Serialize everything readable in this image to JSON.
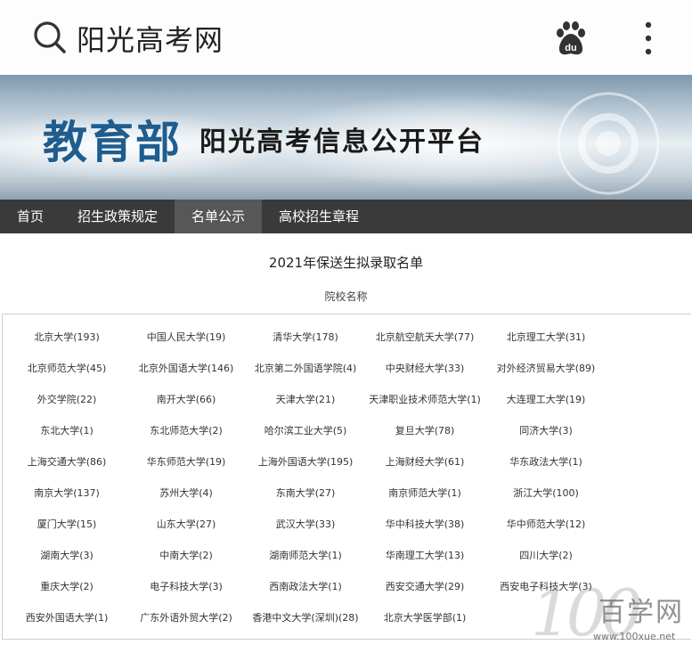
{
  "appbar": {
    "title": "阳光高考网",
    "icons": [
      "search-icon",
      "baidu-paw-icon",
      "more-vertical-icon"
    ]
  },
  "banner": {
    "ministry": "教育部",
    "platform": "阳光高考信息公开平台"
  },
  "nav": {
    "items": [
      {
        "label": "首页"
      },
      {
        "label": "招生政策规定"
      },
      {
        "label": "名单公示",
        "active": true
      },
      {
        "label": "高校招生章程"
      }
    ]
  },
  "page": {
    "heading": "2021年保送生拟录取名单",
    "column_heading": "院校名称"
  },
  "schools": [
    [
      "北京大学(193)",
      "中国人民大学(19)",
      "清华大学(178)",
      "北京航空航天大学(77)",
      "北京理工大学(31)"
    ],
    [
      "北京师范大学(45)",
      "北京外国语大学(146)",
      "北京第二外国语学院(4)",
      "中央财经大学(33)",
      "对外经济贸易大学(89)"
    ],
    [
      "外交学院(22)",
      "南开大学(66)",
      "天津大学(21)",
      "天津职业技术师范大学(1)",
      "大连理工大学(19)"
    ],
    [
      "东北大学(1)",
      "东北师范大学(2)",
      "哈尔滨工业大学(5)",
      "复旦大学(78)",
      "同济大学(3)"
    ],
    [
      "上海交通大学(86)",
      "华东师范大学(19)",
      "上海外国语大学(195)",
      "上海财经大学(61)",
      "华东政法大学(1)"
    ],
    [
      "南京大学(137)",
      "苏州大学(4)",
      "东南大学(27)",
      "南京师范大学(1)",
      "浙江大学(100)"
    ],
    [
      "厦门大学(15)",
      "山东大学(27)",
      "武汉大学(33)",
      "华中科技大学(38)",
      "华中师范大学(12)"
    ],
    [
      "湖南大学(3)",
      "中南大学(2)",
      "湖南师范大学(1)",
      "华南理工大学(13)",
      "四川大学(2)"
    ],
    [
      "重庆大学(2)",
      "电子科技大学(3)",
      "西南政法大学(1)",
      "西安交通大学(29)",
      "西安电子科技大学(3)"
    ],
    [
      "西安外国语大学(1)",
      "广东外语外贸大学(2)",
      "香港中文大学(深圳)(28)",
      "北京大学医学部(1)"
    ]
  ],
  "watermark": {
    "number": "100",
    "text": "百学网",
    "url": "www.100xue.net"
  },
  "colors": {
    "nav_bg": "#3a3a3a",
    "nav_active": "#575757",
    "ministry_blue": "#1f5d8f"
  }
}
